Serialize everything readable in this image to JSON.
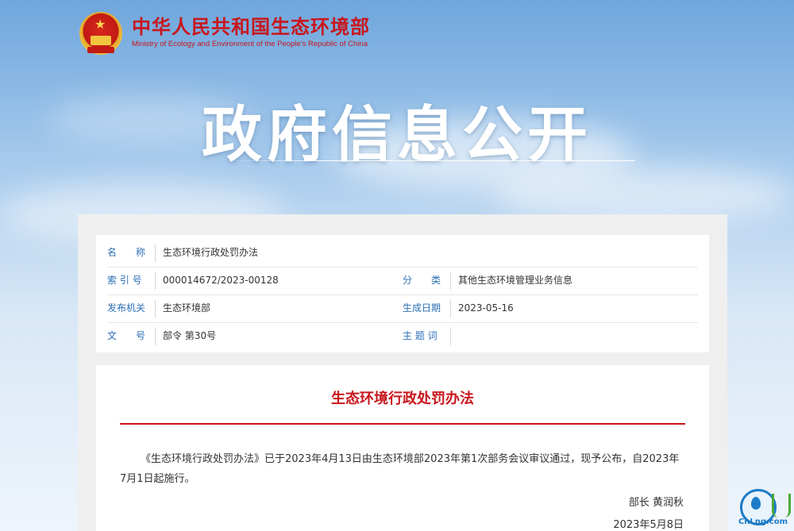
{
  "header": {
    "ministry_cn": "中华人民共和国生态环境部",
    "ministry_en": "Ministry of Ecology and Environment of the People's Republic of China"
  },
  "banner": {
    "title": "政府信息公开"
  },
  "meta": {
    "name_label": "名　　称",
    "name_value": "生态环境行政处罚办法",
    "index_label": "索 引 号",
    "index_value": "000014672/2023-00128",
    "category_label": "分　　类",
    "category_value": "其他生态环境管理业务信息",
    "issuer_label": "发布机关",
    "issuer_value": "生态环境部",
    "date_label": "生成日期",
    "date_value": "2023-05-16",
    "docno_label": "文　　号",
    "docno_value": "部令 第30号",
    "subject_label": "主 题 词",
    "subject_value": ""
  },
  "document": {
    "title": "生态环境行政处罚办法",
    "paragraph": "《生态环境行政处罚办法》已于2023年4月13日由生态环境部2023年第1次部务会议审议通过，现予公布，自2023年7月1日起施行。",
    "signer": "部长 黄润秋",
    "date": "2023年5月8日"
  },
  "watermark": {
    "text": "CnLng.com"
  },
  "colors": {
    "brand_red": "#c8161d",
    "label_blue": "#2b6fb6"
  }
}
